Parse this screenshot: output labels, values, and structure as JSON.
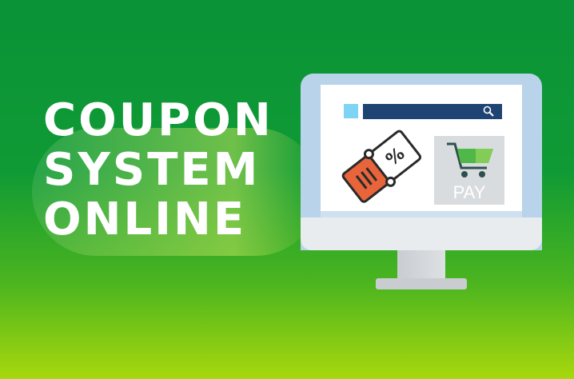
{
  "headline": {
    "line1": "COUPON",
    "line2": "SYSTEM",
    "line3": "ONLINE"
  },
  "pay_card": {
    "label": "PAY"
  },
  "coupon": {
    "symbol": "%"
  },
  "colors": {
    "background_top": "#0a9337",
    "background_bottom": "#a8d80d",
    "search_bar": "#1f4373",
    "coupon_orange": "#e8643a",
    "cart_green": "#4fb848",
    "monitor_frame": "#b9d3ea"
  },
  "icons": [
    "search-icon",
    "coupon-ticket-icon",
    "shopping-cart-icon",
    "monitor-icon"
  ]
}
